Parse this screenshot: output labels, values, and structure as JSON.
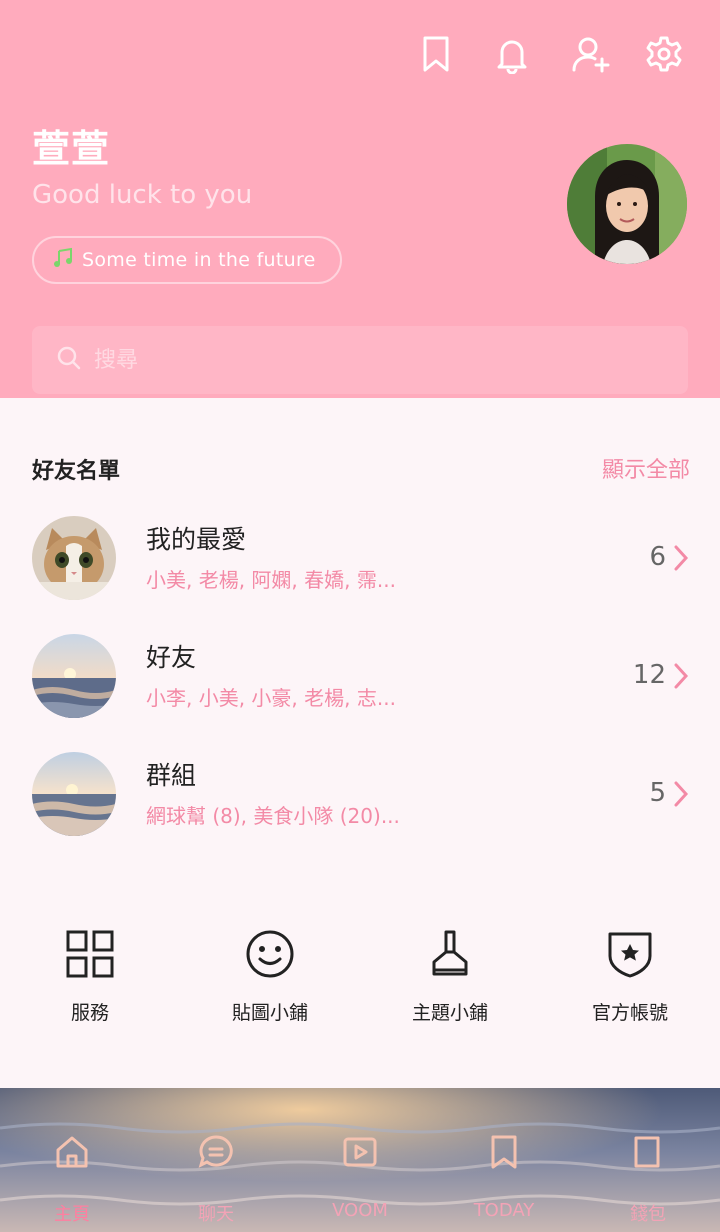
{
  "header": {
    "profile_name": "萱萱",
    "status_message": "Good luck to you",
    "music": "Some time in the future",
    "icons": [
      "bookmark-icon",
      "bell-icon",
      "add-friend-icon",
      "settings-icon"
    ]
  },
  "search": {
    "placeholder": "搜尋"
  },
  "friends": {
    "title": "好友名單",
    "show_all": "顯示全部",
    "rows": [
      {
        "title": "我的最愛",
        "subtitle": "小美, 老楊, 阿嫻, 春嬌, 霈...",
        "count": "6"
      },
      {
        "title": "好友",
        "subtitle": "小李, 小美, 小豪, 老楊, 志...",
        "count": "12"
      },
      {
        "title": "群組",
        "subtitle": "網球幫 (8), 美食小隊 (20)...",
        "count": "5"
      }
    ]
  },
  "shortcuts": [
    {
      "label": "服務",
      "icon": "grid-icon"
    },
    {
      "label": "貼圖小鋪",
      "icon": "smiley-icon"
    },
    {
      "label": "主題小鋪",
      "icon": "brush-icon"
    },
    {
      "label": "官方帳號",
      "icon": "shield-star-icon"
    }
  ],
  "nav": [
    {
      "label": "主頁",
      "icon": "home-icon"
    },
    {
      "label": "聊天",
      "icon": "chat-icon"
    },
    {
      "label": "VOOM",
      "icon": "play-icon"
    },
    {
      "label": "TODAY",
      "icon": "bookmark-icon"
    },
    {
      "label": "錢包",
      "icon": "wallet-icon"
    }
  ],
  "colors": {
    "header": "#ffabbd",
    "accent": "#f38aa6",
    "background": "#fdf5f8"
  }
}
